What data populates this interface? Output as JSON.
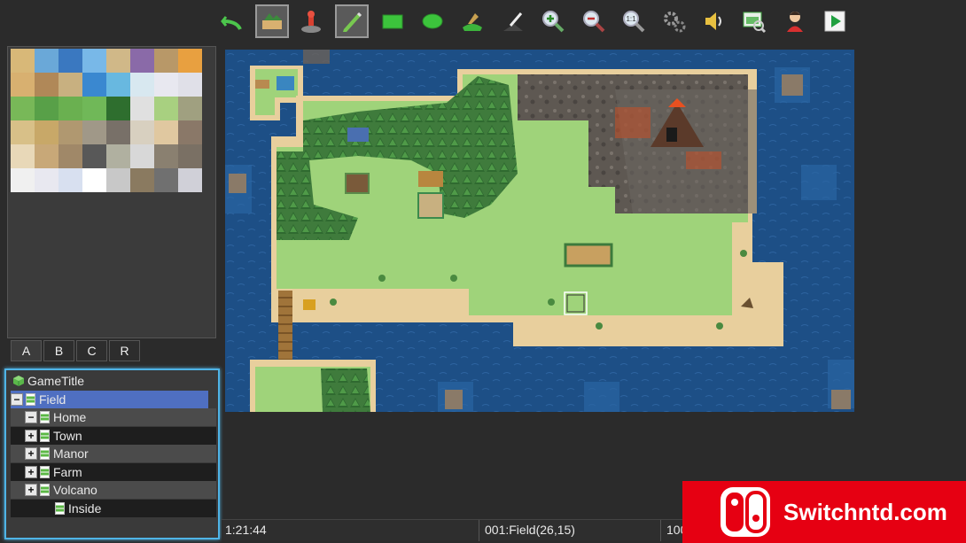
{
  "toolbar": {
    "buttons": [
      {
        "name": "undo-icon"
      },
      {
        "name": "map-mode-icon",
        "active": true
      },
      {
        "name": "event-mode-icon"
      },
      {
        "name": "pencil-icon",
        "active": true
      },
      {
        "name": "rectangle-icon"
      },
      {
        "name": "ellipse-icon"
      },
      {
        "name": "fill-icon"
      },
      {
        "name": "shadow-pen-icon"
      },
      {
        "name": "zoom-in-icon"
      },
      {
        "name": "zoom-out-icon"
      },
      {
        "name": "zoom-actual-icon"
      },
      {
        "name": "database-icon"
      },
      {
        "name": "sound-test-icon"
      },
      {
        "name": "resource-manager-icon"
      },
      {
        "name": "character-generator-icon"
      },
      {
        "name": "playtest-icon"
      }
    ]
  },
  "tile_tabs": [
    "A",
    "B",
    "C",
    "R"
  ],
  "tree": {
    "project": "GameTitle",
    "items": [
      {
        "label": "Field",
        "toggle": "−"
      },
      {
        "label": "Home",
        "toggle": "−"
      },
      {
        "label": "Town",
        "toggle": "+"
      },
      {
        "label": "Manor",
        "toggle": "+"
      },
      {
        "label": "Farm",
        "toggle": "+"
      },
      {
        "label": "Volcano",
        "toggle": "+"
      },
      {
        "label": "Inside",
        "toggle": ""
      }
    ]
  },
  "status": {
    "time": "1:21:44",
    "map_info": "001:Field(26,15)",
    "zoom": "100"
  },
  "watermark": {
    "text": "Switchntd.com"
  },
  "colors": {
    "ocean": "#1d4f86",
    "grass": "#9fd37a",
    "sand": "#e8cf9d",
    "forest": "#3e7c3e",
    "rock": "#6b6560",
    "accent": "#4fb4e6",
    "brand": "#e60012"
  }
}
